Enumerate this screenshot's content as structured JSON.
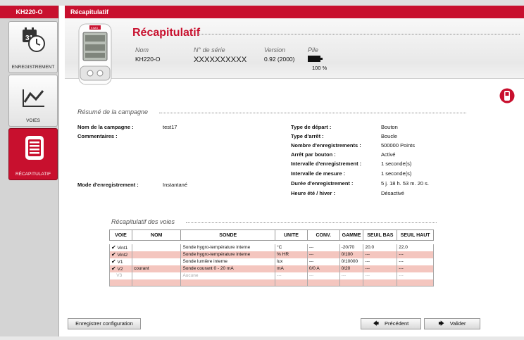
{
  "sidebar": {
    "title": "KH220-O",
    "items": [
      {
        "label": "ENREGISTREMENT",
        "icon": "calendar-clock-icon",
        "day": "31"
      },
      {
        "label": "VOIES",
        "icon": "line-chart-icon"
      },
      {
        "label": "RÉCAPITULATIF",
        "icon": "document-list-icon"
      }
    ]
  },
  "header": {
    "bar_title": "Récapitulatif",
    "title": "Récapitulatif",
    "device_brand": "KIMO",
    "columns": {
      "nom": {
        "label": "Nom",
        "value": "KH220-O"
      },
      "serie": {
        "label": "N° de série",
        "value": "XXXXXXXXXX"
      },
      "version": {
        "label": "Version",
        "value": "0.92 (2000)"
      },
      "pile": {
        "label": "Pile",
        "value": "100 %"
      }
    }
  },
  "campaign": {
    "section_title": "Résumé de la campagne",
    "left": [
      {
        "label": "Nom de la campagne :",
        "value": "test17"
      },
      {
        "label": "Commentaires :",
        "value": ""
      },
      {
        "label": "Mode d'enregistrement :",
        "value": "Instantané"
      }
    ],
    "right": [
      {
        "label": "Type de départ :",
        "value": "Bouton"
      },
      {
        "label": "Type d'arrêt :",
        "value": "Boucle"
      },
      {
        "label": "Nombre d'enregistrements :",
        "value": "500000 Points"
      },
      {
        "label": "Arrêt par bouton :",
        "value": "Activé"
      },
      {
        "label": "Intervalle d'enregistrement :",
        "value": "1 seconde(s)"
      },
      {
        "label": "Intervalle de mesure :",
        "value": "1 seconde(s)"
      },
      {
        "label": "Durée d'enregistrement :",
        "value": "5 j. 18 h. 53 m. 20 s."
      },
      {
        "label": "Heure été / hiver :",
        "value": "Désactivé"
      }
    ]
  },
  "voies": {
    "section_title": "Récapitulatif des voies",
    "headers": [
      "VOIE",
      "NOM",
      "SONDE",
      "UNITE",
      "CONV.",
      "GAMME",
      "SEUIL BAS",
      "SEUIL HAUT"
    ],
    "rows": [
      {
        "checked": true,
        "voie": "Vint1",
        "nom": "",
        "sonde": "Sonde hygro-température interne",
        "unite": "°C",
        "conv": "---",
        "gamme": "-20/70",
        "seuil_bas": "20.0",
        "seuil_haut": "22.0",
        "disabled": false
      },
      {
        "checked": true,
        "voie": "Vint2",
        "nom": "",
        "sonde": "Sonde hygro-température interne",
        "unite": "% HR",
        "conv": "---",
        "gamme": "0/100",
        "seuil_bas": "---",
        "seuil_haut": "---",
        "disabled": false
      },
      {
        "checked": true,
        "voie": "V1",
        "nom": "",
        "sonde": "Sonde lumière interne",
        "unite": "lux",
        "conv": "---",
        "gamme": "0/10000",
        "seuil_bas": "---",
        "seuil_haut": "---",
        "disabled": false
      },
      {
        "checked": true,
        "voie": "V2",
        "nom": "courant",
        "sonde": "Sonde courant 0 - 20 mA",
        "unite": "mA",
        "conv": "0/0 A",
        "gamme": "0/20",
        "seuil_bas": "---",
        "seuil_haut": "---",
        "disabled": false
      },
      {
        "checked": false,
        "voie": "V3",
        "nom": "",
        "sonde": "Aucune",
        "unite": "---",
        "conv": "---",
        "gamme": "---",
        "seuil_bas": "---",
        "seuil_haut": "---",
        "disabled": true
      }
    ]
  },
  "buttons": {
    "save": "Enregistrer configuration",
    "prev": "Précédent",
    "next": "Valider"
  },
  "colors": {
    "accent": "#c8102e",
    "row_alt": "#f4c6bf"
  }
}
